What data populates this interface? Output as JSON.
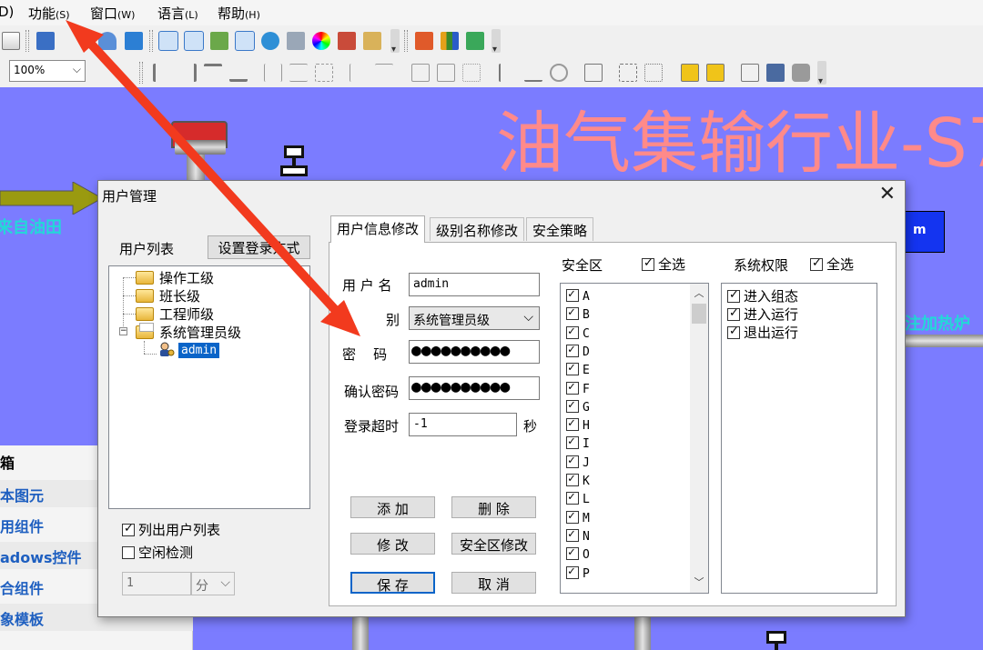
{
  "menu": [
    {
      "label": "功能",
      "key": "(S)"
    },
    {
      "label": "窗口",
      "key": "(W)"
    },
    {
      "label": "语言",
      "key": "(L)"
    },
    {
      "label": "帮助",
      "key": "(H)"
    }
  ],
  "menu_partial": "D)",
  "zoom": {
    "value": "100%"
  },
  "canvas": {
    "headline": "油气集输行业-S7",
    "label_oil": "来自油田",
    "label_heater": "注加热炉",
    "blue_box": "m"
  },
  "toolbox": {
    "title": "箱",
    "items": [
      "本图元",
      "用组件",
      "adows控件",
      "合组件",
      "象模板"
    ]
  },
  "dialog": {
    "title": "用户管理",
    "close": "✕",
    "user_list_label": "用户列表",
    "login_mode_button": "设置登录方式",
    "tree": {
      "groups": [
        "操作工级",
        "班长级",
        "工程师级",
        "系统管理员级"
      ],
      "selected_user": "admin"
    },
    "list_users_checkbox": {
      "label": "列出用户列表",
      "checked": true
    },
    "idle_check_checkbox": {
      "label": "空闲检测",
      "checked": false
    },
    "idle_minutes": {
      "value": "1",
      "unit": "分"
    },
    "tabs": [
      "用户信息修改",
      "级别名称修改",
      "安全策略"
    ],
    "form": {
      "username_label": "用 户 名",
      "username_value": "admin",
      "level_label": "别",
      "level_value": "系统管理员级",
      "password_label": "密    码",
      "password_value": "●●●●●●●●●●",
      "confirm_label": "确认密码",
      "confirm_value": "●●●●●●●●●●",
      "timeout_label": "登录超时",
      "timeout_value": "-1",
      "timeout_unit": "秒"
    },
    "buttons": {
      "add": "添 加",
      "delete": "删 除",
      "modify": "修 改",
      "zone_modify": "安全区修改",
      "save": "保 存",
      "cancel": "取 消"
    },
    "security_zone": {
      "label": "安全区",
      "select_all": "全选",
      "items": [
        "A",
        "B",
        "C",
        "D",
        "E",
        "F",
        "G",
        "H",
        "I",
        "J",
        "K",
        "L",
        "M",
        "N",
        "O",
        "P"
      ]
    },
    "permissions": {
      "label": "系统权限",
      "select_all": "全选",
      "items": [
        "进入组态",
        "进入运行",
        "退出运行"
      ]
    }
  },
  "colors": {
    "canvas": "#7b7cff",
    "headline": "#ff8a8a",
    "accent": "#0a64c8",
    "annotation_arrow": "#f23a1e"
  }
}
